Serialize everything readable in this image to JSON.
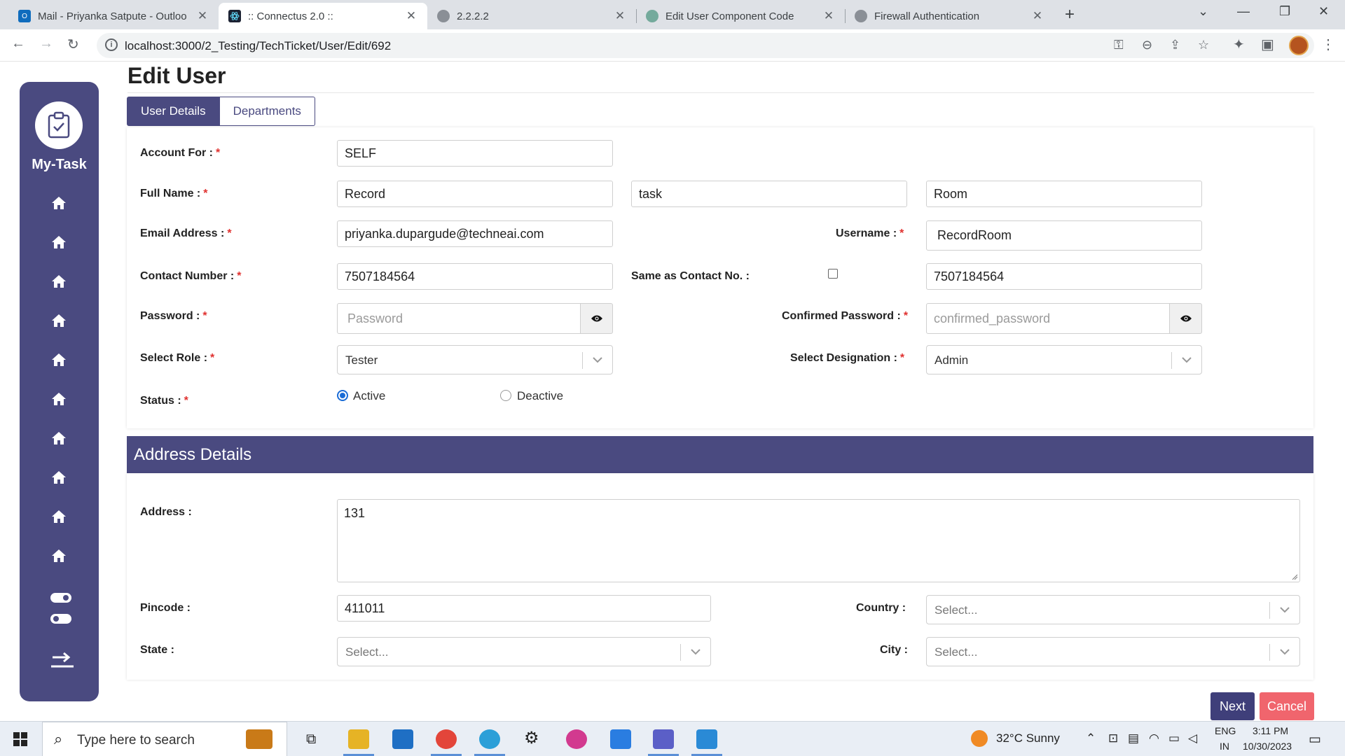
{
  "browser": {
    "tabs": [
      {
        "title": "Mail - Priyanka Satpute - Outloo",
        "icon": "outlook-icon",
        "active": false
      },
      {
        "title": ":: Connectus 2.0 ::",
        "icon": "react-icon",
        "active": true
      },
      {
        "title": "2.2.2.2",
        "icon": "globe-icon",
        "active": false
      },
      {
        "title": "Edit User Component Code",
        "icon": "chatgpt-icon",
        "active": false
      },
      {
        "title": "Firewall Authentication",
        "icon": "globe-icon",
        "active": false
      }
    ],
    "url": "localhost:3000/2_Testing/TechTicket/User/Edit/692"
  },
  "sidebar": {
    "app_name": "My-Task",
    "items": [
      "home-icon",
      "home-icon",
      "home-icon",
      "home-icon",
      "home-icon",
      "home-icon",
      "home-icon",
      "home-icon",
      "home-icon",
      "home-icon"
    ]
  },
  "page": {
    "title": "Edit User",
    "tabs": [
      "User Details",
      "Departments"
    ]
  },
  "form": {
    "account_for": {
      "label": "Account For :",
      "value": "SELF"
    },
    "full_name": {
      "label": "Full Name :",
      "first": "Record",
      "middle": "task",
      "last": "Room"
    },
    "email": {
      "label": "Email Address :",
      "value": "priyanka.dupargude@techneai.com"
    },
    "username": {
      "label": "Username :",
      "value": "RecordRoom"
    },
    "contact": {
      "label": "Contact Number :",
      "value": "7507184564"
    },
    "same_as_contact": {
      "label": "Same as Contact No. :",
      "checked": false,
      "value": "7507184564"
    },
    "password": {
      "label": "Password :",
      "placeholder": "Password"
    },
    "confirmed_password": {
      "label": "Confirmed Password :",
      "placeholder": "confirmed_password"
    },
    "role": {
      "label": "Select Role :",
      "value": "Tester"
    },
    "designation": {
      "label": "Select Designation :",
      "value": "Admin"
    },
    "status": {
      "label": "Status :",
      "options": [
        "Active",
        "Deactive"
      ],
      "selected": "Active"
    }
  },
  "address": {
    "header": "Address Details",
    "address": {
      "label": "Address :",
      "value": "131"
    },
    "pincode": {
      "label": "Pincode :",
      "value": "411011"
    },
    "country": {
      "label": "Country :",
      "value": "Select..."
    },
    "state": {
      "label": "State :",
      "value": "Select..."
    },
    "city": {
      "label": "City :",
      "value": "Select..."
    }
  },
  "actions": {
    "next": "Next",
    "cancel": "Cancel"
  },
  "taskbar": {
    "search_placeholder": "Type here to search",
    "weather": "32°C  Sunny",
    "lang": "ENG",
    "region": "IN",
    "time": "3:11 PM",
    "date": "10/30/2023"
  },
  "colors": {
    "primary": "#4a4a80",
    "required": "#e0312f",
    "cancel": "#f0656d",
    "radio": "#1a6cd6"
  }
}
